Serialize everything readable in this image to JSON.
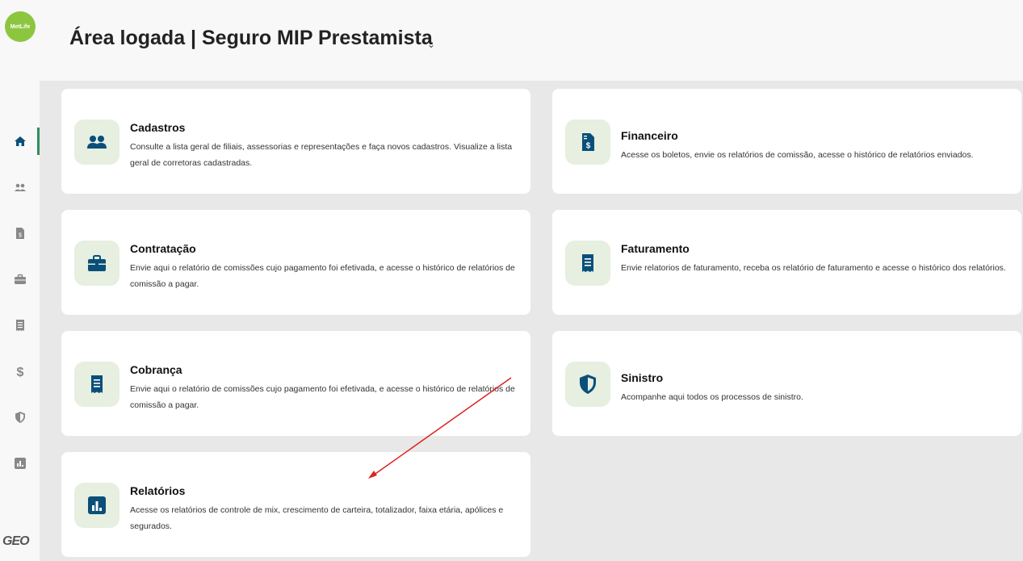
{
  "sidebar": {
    "logo_text": "MetLife",
    "footer_logo": "GEO",
    "items": [
      {
        "name": "home-icon",
        "active": true
      },
      {
        "name": "users-icon",
        "active": false
      },
      {
        "name": "invoice-icon",
        "active": false
      },
      {
        "name": "briefcase-icon",
        "active": false
      },
      {
        "name": "receipt-icon",
        "active": false
      },
      {
        "name": "dollar-icon",
        "active": false
      },
      {
        "name": "shield-icon",
        "active": false
      },
      {
        "name": "chart-icon",
        "active": false
      }
    ]
  },
  "header": {
    "title": "Área logada | Seguro MIP Prestamista",
    "chevron": "⌄"
  },
  "cards": [
    {
      "title": "Cadastros",
      "desc": "Consulte a lista geral de filiais, assessorias e representações e faça novos cadastros. Visualize a lista geral de corretoras cadastradas.",
      "icon": "users-icon"
    },
    {
      "title": "Financeiro",
      "desc": "Acesse os boletos, envie os relatórios de comissão, acesse o histórico de relatórios enviados.",
      "icon": "invoice-icon"
    },
    {
      "title": "Contratação",
      "desc": "Envie aqui o relatório de comissões cujo pagamento foi efetivada, e acesse o histórico de relatórios de comissão a pagar.",
      "icon": "briefcase-icon"
    },
    {
      "title": "Faturamento",
      "desc": "Envie relatorios de faturamento, receba os relatório de faturamento e acesse o histórico dos relatórios.",
      "icon": "receipt-icon"
    },
    {
      "title": "Cobrança",
      "desc": "Envie aqui o relatório de comissões cujo pagamento foi efetivada, e acesse o histórico de relatórios de comissão a pagar.",
      "icon": "receipt-icon"
    },
    {
      "title": "Sinistro",
      "desc": "Acompanhe aqui todos os processos de sinistro.",
      "icon": "shield-icon"
    },
    {
      "title": "Relatórios",
      "desc": "Acesse os relatórios de controle de mix, crescimento de carteira, totalizador, faixa etária, apólices e segurados.",
      "icon": "chart-icon"
    }
  ],
  "colors": {
    "accent": "#0a4f7a",
    "icon_bg": "#e6efe0",
    "logo_green": "#8cc63f",
    "annotation_arrow": "#e02020"
  }
}
